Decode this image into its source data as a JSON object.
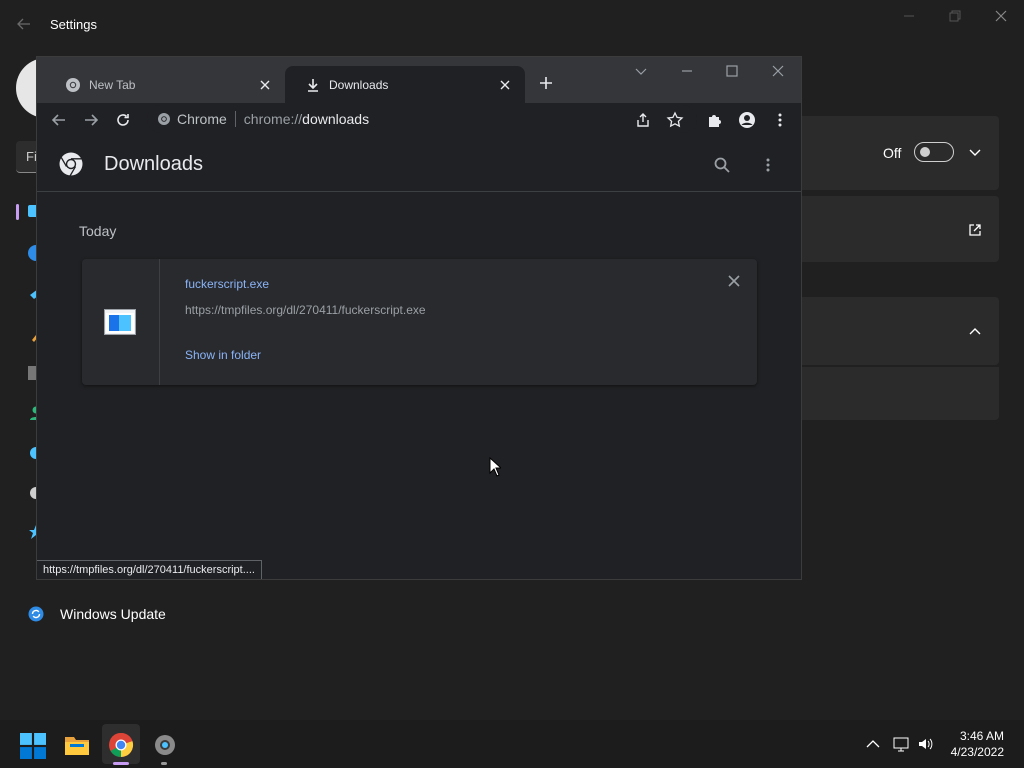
{
  "settings": {
    "title": "Settings",
    "search_placeholder": "Fi",
    "toggle_label": "Off",
    "windows_update_label": "Windows Update"
  },
  "chrome": {
    "tabs": [
      {
        "label": "New Tab",
        "active": false
      },
      {
        "label": "Downloads",
        "active": true
      }
    ],
    "omnibox": {
      "site_chip": "Chrome",
      "url_scheme": "chrome://",
      "url_path": "downloads"
    },
    "page": {
      "title": "Downloads",
      "date_heading": "Today",
      "item": {
        "file_name": "fuckerscript.exe",
        "url": "https://tmpfiles.org/dl/270411/fuckerscript.exe",
        "action_label": "Show in folder"
      }
    },
    "status_bubble": "https://tmpfiles.org/dl/270411/fuckerscript...."
  },
  "taskbar": {
    "time": "3:46 AM",
    "date": "4/23/2022"
  },
  "colors": {
    "link": "#8ab4f8",
    "chrome_bg": "#202124",
    "tabstrip": "#35363a",
    "settings_bg": "#202020",
    "accent": "#0078d4"
  }
}
